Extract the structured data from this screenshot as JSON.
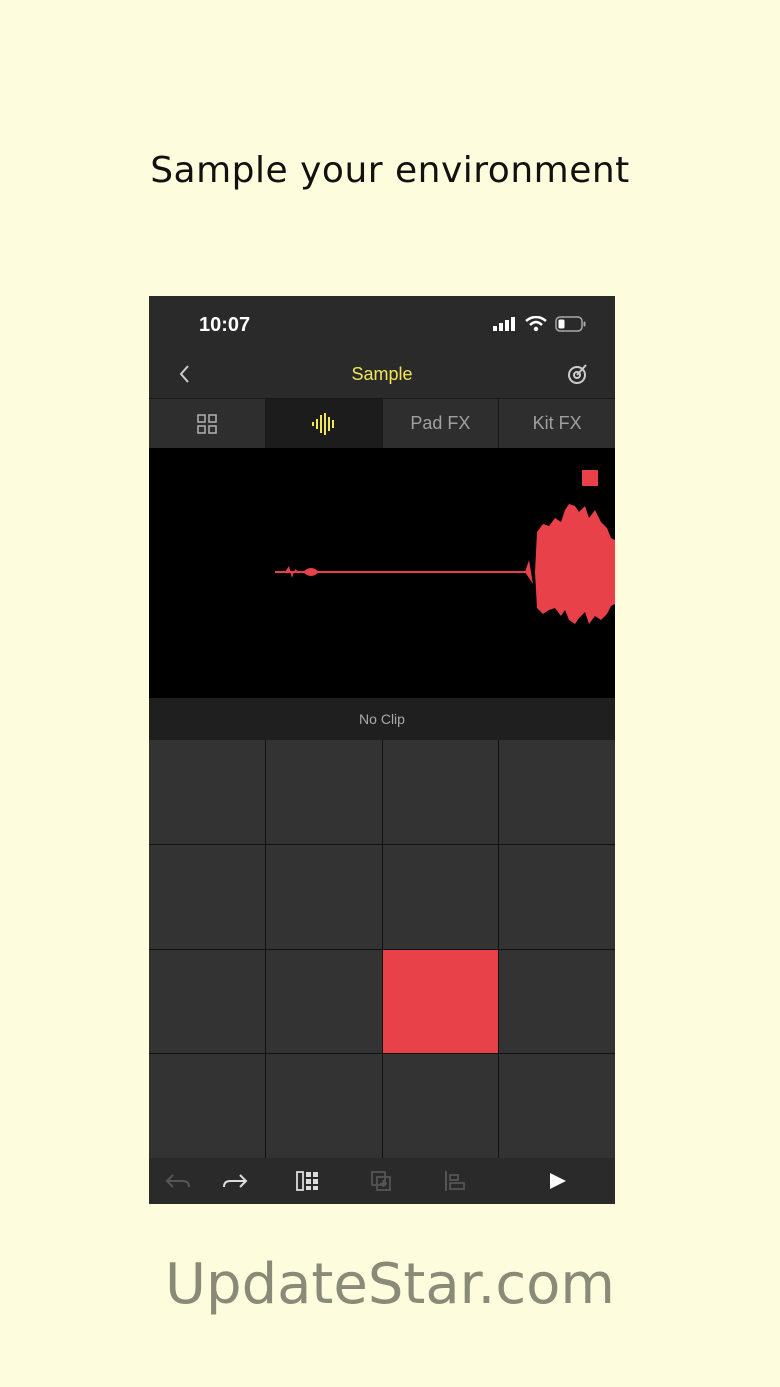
{
  "headline": "Sample your environment",
  "status": {
    "time": "10:07"
  },
  "nav": {
    "title": "Sample"
  },
  "tabs": [
    {
      "icon": "grid-icon",
      "label": ""
    },
    {
      "icon": "waveform-icon",
      "label": ""
    },
    {
      "label": "Pad FX"
    },
    {
      "label": "Kit FX"
    }
  ],
  "clip": {
    "label": "No Clip"
  },
  "pads": {
    "rows": 4,
    "cols": 4,
    "active_index": 10
  },
  "colors": {
    "accent_yellow": "#f2e55a",
    "record_red": "#e8414a",
    "background": "#fdfcdc"
  },
  "watermark": "UpdateStar.com"
}
